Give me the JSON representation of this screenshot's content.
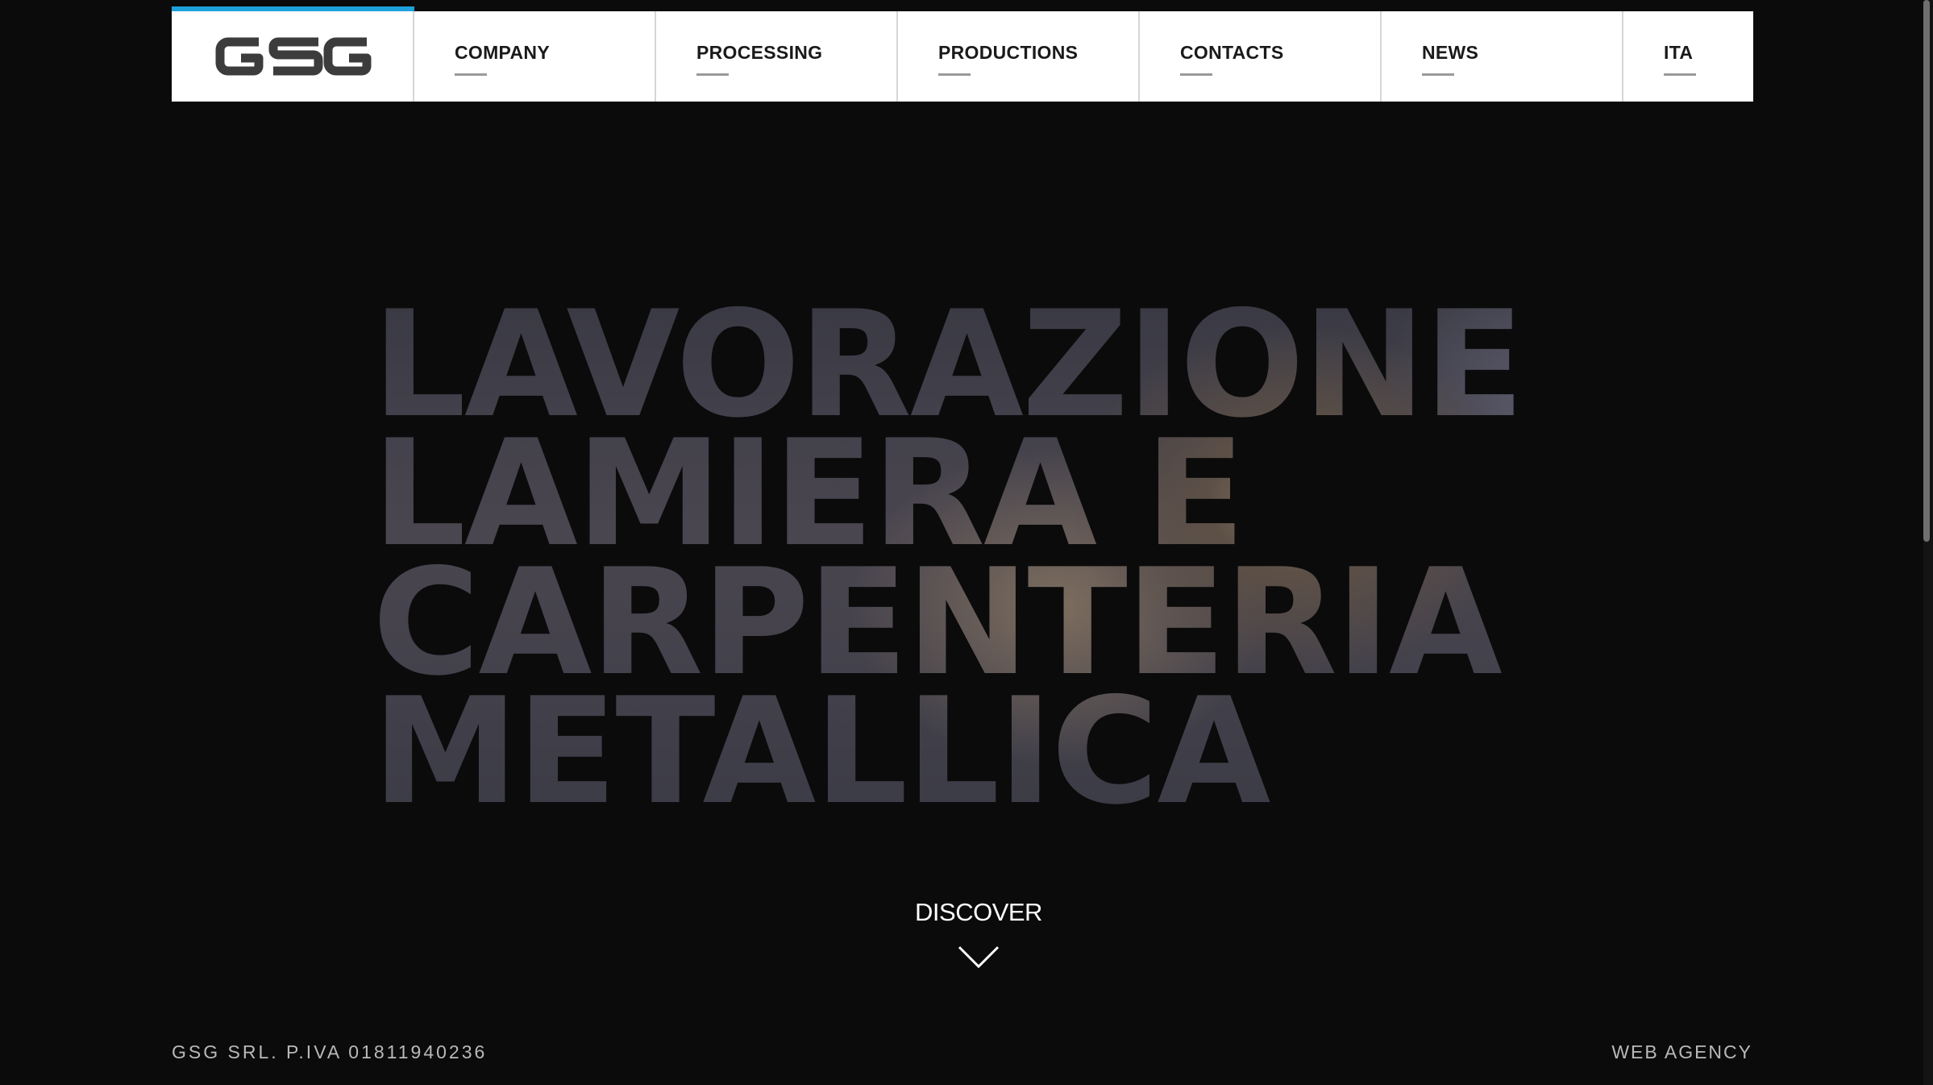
{
  "nav": {
    "logo_text": "GSG",
    "accent_color": "#1ea2dc",
    "items": [
      {
        "label": "COMPANY"
      },
      {
        "label": "PROCESSING"
      },
      {
        "label": "PRODUCTIONS"
      },
      {
        "label": "CONTACTS"
      },
      {
        "label": "NEWS"
      },
      {
        "label": "ITA"
      }
    ]
  },
  "hero": {
    "lines": [
      "LAVORAZIONE",
      "LAMIERA E",
      "CARPENTERIA",
      "METALLICA"
    ],
    "discover_label": "DISCOVER",
    "discover_icon": "chevron-down-icon"
  },
  "footer": {
    "left_text": "GSG SRL. P.IVA 01811940236",
    "right_text": "WEB AGENCY"
  }
}
